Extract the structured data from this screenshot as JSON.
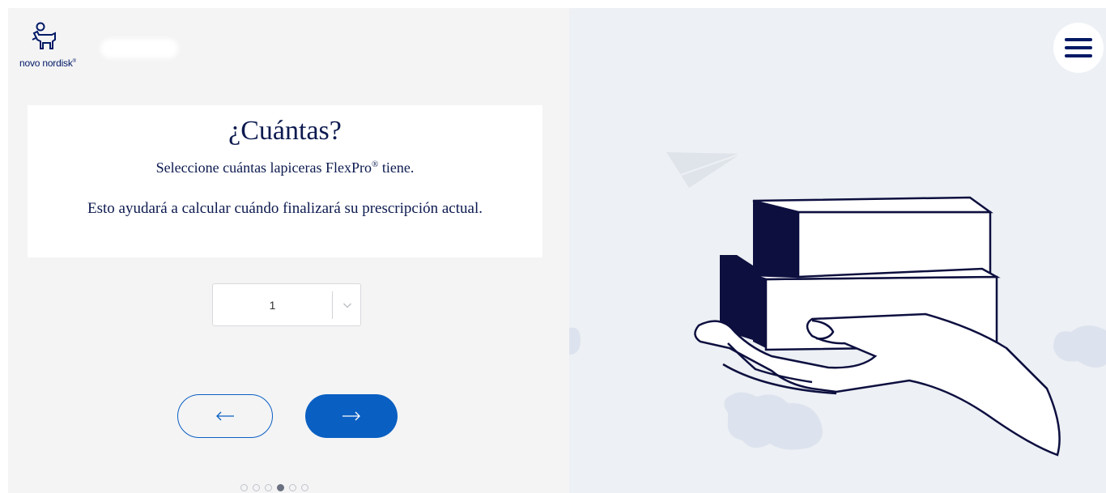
{
  "brand": {
    "logo_text": "novo nordisk",
    "logo_mark": "®"
  },
  "question": {
    "title": "¿Cuántas?",
    "subtitle_prefix": "Seleccione cuántas lapiceras FlexPro",
    "subtitle_mark": "®",
    "subtitle_suffix": " tiene.",
    "help_text": "Esto ayudará a calcular cuándo finalizará su prescripción actual."
  },
  "quantity_select": {
    "value": "1",
    "icon": "chevron-down-icon"
  },
  "navigation": {
    "prev_icon": "arrow-left-icon",
    "next_icon": "arrow-right-icon"
  },
  "progress": {
    "total_steps": 6,
    "current_step": 4
  },
  "menu": {
    "icon": "hamburger-menu-icon"
  },
  "colors": {
    "brand_navy": "#001965",
    "primary_blue": "#0a5fc2",
    "left_bg": "#f4f4f5",
    "right_bg": "#edf0f4"
  }
}
